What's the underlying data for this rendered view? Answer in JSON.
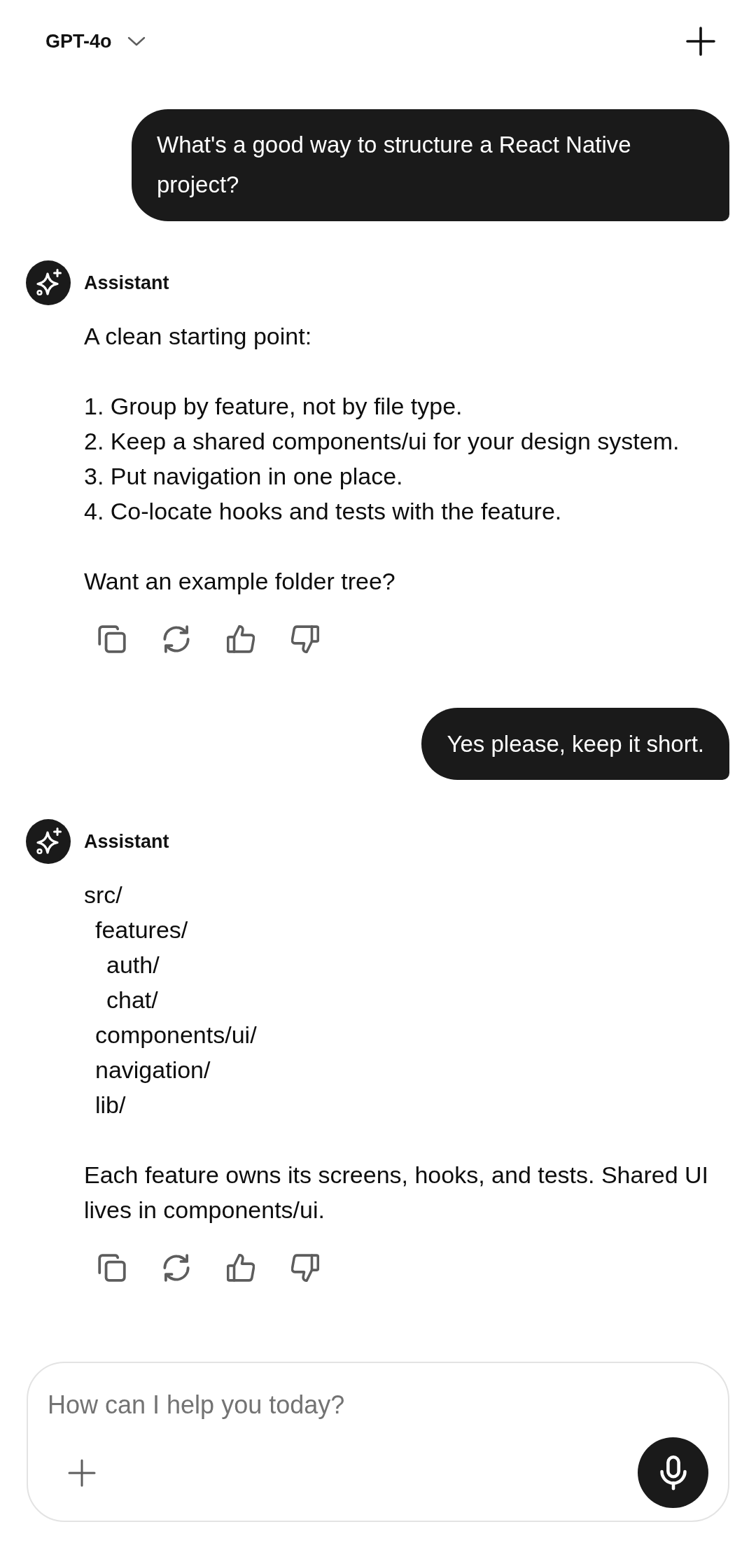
{
  "top_bar": {
    "model": "GPT-4o"
  },
  "messages": [
    {
      "kind": "user",
      "text": "What's a good way to structure a React Native project?"
    },
    {
      "kind": "assistant",
      "author": "Assistant",
      "blocks": [
        {
          "kind": "paragraph",
          "text": "A clean starting point:"
        },
        {
          "kind": "list",
          "items": [
            "1. Group by feature, not by file type.",
            "2. Keep a shared components/ui for your design system.",
            "3. Put navigation in one place.",
            "4. Co-locate hooks and tests with the feature."
          ]
        },
        {
          "kind": "paragraph",
          "text": "Want an example folder tree?"
        }
      ]
    },
    {
      "kind": "user",
      "text": "Yes please, keep it short."
    },
    {
      "kind": "assistant",
      "author": "Assistant",
      "blocks": [
        {
          "kind": "tree",
          "items": [
            {
              "name": "src/",
              "children": [
                {
                  "name": "features/",
                  "children": [
                    {
                      "name": "auth/"
                    },
                    {
                      "name": "chat/"
                    }
                  ]
                },
                {
                  "name": "components/ui/"
                },
                {
                  "name": "navigation/"
                },
                {
                  "name": "lib/"
                }
              ]
            }
          ]
        },
        {
          "kind": "paragraph",
          "text": "Each feature owns its screens, hooks, and tests. Shared UI lives in components/ui."
        }
      ]
    }
  ],
  "composer": {
    "placeholder": "How can I help you today?"
  }
}
